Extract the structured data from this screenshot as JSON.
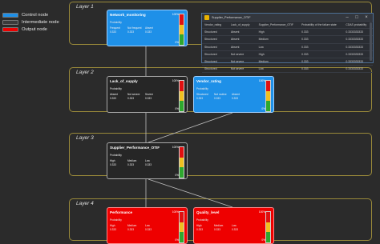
{
  "legend": [
    {
      "label": "Control node",
      "color": "#1e90e8"
    },
    {
      "label": "Intermediate node",
      "color": "#3a3a3a"
    },
    {
      "label": "Output node",
      "color": "#ee0000"
    }
  ],
  "layers": [
    "Layer 1",
    "Layer 2",
    "Layer 3",
    "Layer 4"
  ],
  "nodes": {
    "network_monitoring": {
      "title": "Network_monitoring",
      "sub": "Probability",
      "states": [
        "Frequent",
        "Not frequent",
        "Absent"
      ],
      "values": [
        "0.333",
        "0.333",
        "0.333"
      ],
      "top": "100%",
      "bottom": "0%"
    },
    "lack_of_supply": {
      "title": "Lack_of_supply",
      "sub": "Probability",
      "states": [
        "Absent",
        "Not severe",
        "Severe"
      ],
      "values": [
        "0.333",
        "0.333",
        "0.333"
      ],
      "top": "100%",
      "bottom": "0%"
    },
    "vendor_rating": {
      "title": "Vendor_rating",
      "sub": "Probability",
      "states": [
        "Structured",
        "Not routine",
        "Absent"
      ],
      "values": [
        "0.333",
        "0.333",
        "0.333"
      ],
      "top": "100%",
      "bottom": "0%"
    },
    "supplier_otif": {
      "title": "Supplier_Performance_OTIF",
      "sub": "Probability",
      "states": [
        "High",
        "Medium",
        "Low"
      ],
      "values": [
        "0.333",
        "0.333",
        "0.333"
      ],
      "top": "100%",
      "bottom": "0%"
    },
    "performance": {
      "title": "Performance",
      "sub": "Probability",
      "states": [
        "High",
        "Medium",
        "Low"
      ],
      "values": [
        "0.333",
        "0.333",
        "0.333"
      ],
      "top": "100%",
      "bottom": "0%"
    },
    "quality_level": {
      "title": "Quality_level",
      "sub": "Probability",
      "states": [
        "High",
        "Medium",
        "Low"
      ],
      "values": [
        "0.333",
        "0.333",
        "0.333"
      ],
      "top": "100%",
      "bottom": "0%"
    }
  },
  "cpt_window": {
    "title": "Supplier_Performance_OTIF",
    "headers": [
      "Vendor_rating",
      "Lack_of_supply",
      "Supplier_Performance_OTIF",
      "Probability of the failure state",
      "CDAS probability"
    ],
    "rows": [
      [
        "Structured",
        "Absent",
        "High",
        "0.333",
        "0.3333333333"
      ],
      [
        "Structured",
        "Absent",
        "Medium",
        "0.333",
        "0.3333333333"
      ],
      [
        "Structured",
        "Absent",
        "Low",
        "0.333",
        "0.3333333333"
      ],
      [
        "Structured",
        "Not severe",
        "High",
        "0.333",
        "0.3333333333"
      ],
      [
        "Structured",
        "Not severe",
        "Medium",
        "0.333",
        "0.3333333333"
      ],
      [
        "Structured",
        "Not severe",
        "Low",
        "0.333",
        "0.3333333333"
      ]
    ]
  }
}
